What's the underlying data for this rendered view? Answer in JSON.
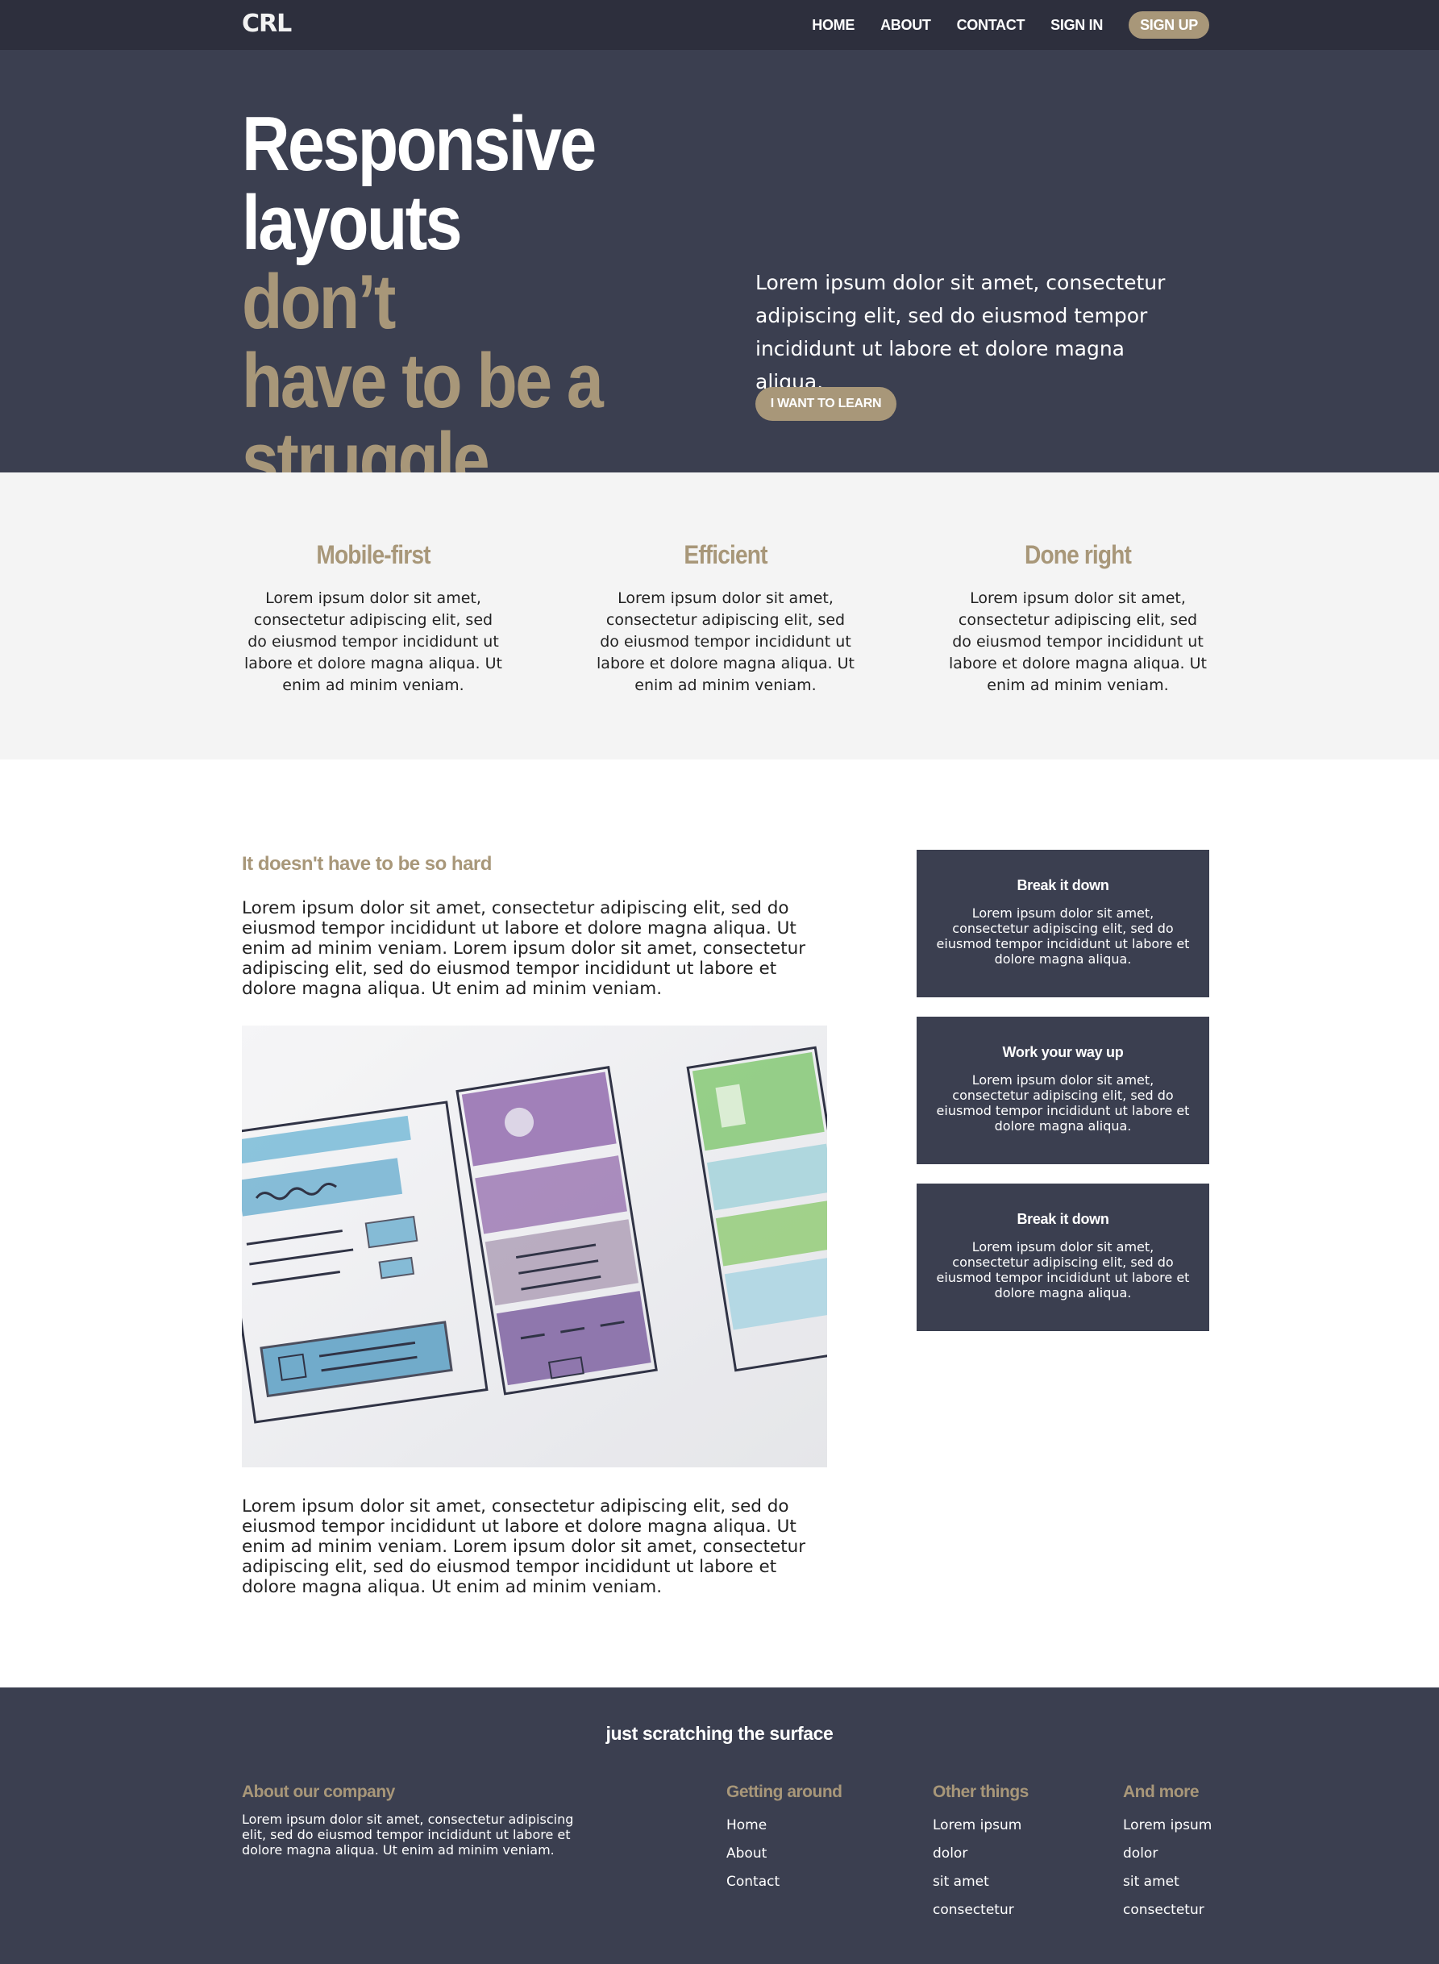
{
  "nav": {
    "logo": "CRL",
    "links": [
      "HOME",
      "ABOUT",
      "CONTACT",
      "SIGN IN"
    ],
    "signup": "SIGN UP"
  },
  "hero": {
    "title_line1": "Responsive",
    "title_line2_a": "layouts ",
    "title_line2_b": "don’t",
    "title_line3": "have to be a",
    "title_line4": "struggle",
    "text": "Lorem ipsum dolor sit amet, consectetur adipiscing elit, sed do eiusmod tempor incididunt ut labore et dolore magna aliqua.",
    "button": "I WANT TO LEARN"
  },
  "features": [
    {
      "title": "Mobile-first",
      "text": "Lorem ipsum dolor sit amet, consectetur adipiscing elit, sed do eiusmod tempor incididunt ut labore et dolore magna aliqua. Ut enim ad minim veniam."
    },
    {
      "title": "Efficient",
      "text": "Lorem ipsum dolor sit amet, consectetur adipiscing elit, sed do eiusmod tempor incididunt ut labore et dolore magna aliqua. Ut enim ad minim veniam."
    },
    {
      "title": "Done right",
      "text": "Lorem ipsum dolor sit amet, consectetur adipiscing elit, sed do eiusmod tempor incididunt ut labore et dolore magna aliqua. Ut enim ad minim veniam."
    }
  ],
  "main": {
    "heading": "It doesn't have to be so hard",
    "para1": "Lorem ipsum dolor sit amet, consectetur adipiscing elit, sed do eiusmod tempor incididunt ut labore et dolore magna aliqua. Ut enim ad minim veniam. Lorem ipsum dolor sit amet, consectetur adipiscing elit, sed do eiusmod tempor incididunt ut labore et dolore magna aliqua. Ut enim ad minim veniam.",
    "para2": "Lorem ipsum dolor sit amet, consectetur adipiscing elit, sed do eiusmod tempor incididunt ut labore et dolore magna aliqua. Ut enim ad minim veniam. Lorem ipsum dolor sit amet, consectetur adipiscing elit, sed do eiusmod tempor incididunt ut labore et dolore magna aliqua. Ut enim ad minim veniam."
  },
  "cards": [
    {
      "title": "Break it down",
      "text": "Lorem ipsum dolor sit amet, consectetur adipiscing elit, sed do eiusmod tempor incididunt ut labore et dolore magna aliqua."
    },
    {
      "title": "Work your way up",
      "text": "Lorem ipsum dolor sit amet, consectetur adipiscing elit, sed do eiusmod tempor incididunt ut labore et dolore magna aliqua."
    },
    {
      "title": "Break it down",
      "text": "Lorem ipsum dolor sit amet, consectetur adipiscing elit, sed do eiusmod tempor incididunt ut labore et dolore magna aliqua."
    }
  ],
  "footer": {
    "title": "just scratching the surface",
    "about_title": "About our company",
    "about_text": "Lorem ipsum dolor sit amet, consectetur adipiscing elit, sed do eiusmod tempor incididunt ut labore et dolore magna aliqua. Ut enim ad minim veniam.",
    "col1_title": "Getting around",
    "col1_items": [
      "Home",
      "About",
      "Contact"
    ],
    "col2_title": "Other things",
    "col2_items": [
      "Lorem ipsum",
      "dolor",
      "sit amet",
      "consectetur"
    ],
    "col3_title": "And more",
    "col3_items": [
      "Lorem ipsum",
      "dolor",
      "sit amet",
      "consectetur"
    ]
  },
  "colors": {
    "dark": "#3b3f50",
    "nav": "#2d2f3d",
    "accent": "#a89779",
    "light_bg": "#f4f4f4"
  }
}
